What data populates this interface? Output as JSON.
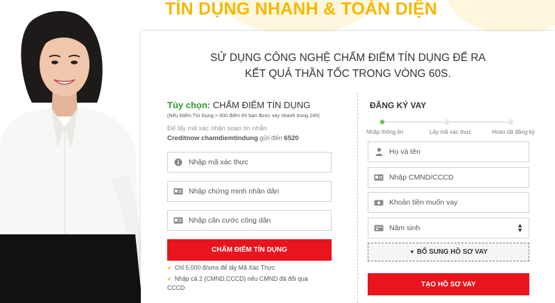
{
  "hero": {
    "title": "TÍN DỤNG NHANH & TOÀN DIỆN"
  },
  "card": {
    "headline_line1": "SỬ DỤNG CÔNG NGHỆ CHẤM ĐIỂM TÍN DỤNG ĐỂ RA",
    "headline_line2": "KẾT QUẢ THẦN TỐC TRONG VÒNG 60S."
  },
  "credit_score": {
    "option_label": "Tùy chọn:",
    "title": "CHẤM ĐIỂM TÍN DỤNG",
    "note": "(Nếu Điểm Tín Dụng > 600 điểm thì bạn được vay nhanh trong 24h)",
    "sms_instruction": "Để lấy mã xác nhận soạn tin nhắn",
    "sms_syntax": "Creditnow chamdiemtindung",
    "sms_send_to": "gửi đến",
    "sms_number": "6520",
    "fields": {
      "verification_code_placeholder": "Nhập mã xác thực",
      "id_card_placeholder": "Nhập chứng minh nhân dân",
      "citizen_id_placeholder": "Nhập căn cước công dân"
    },
    "submit_label": "CHẤM ĐIỂM TÍN DỤNG",
    "tips": [
      "Chỉ 5.000 đ/sms để lấy Mã Xác Thực",
      "Nhập cả 2 (CMND,CCCD) nếu CMND đã đổi qua",
      "CCCD"
    ]
  },
  "register": {
    "title": "ĐĂNG KÝ VAY",
    "steps": [
      "Nhập thông tin",
      "Lấy mã xác thực",
      "Hoàn tất đăng ký"
    ],
    "fields": {
      "full_name_placeholder": "Họ và tên",
      "id_number_placeholder": "Nhập CMND/CCCD",
      "loan_amount_placeholder": "Khoản tiền muốn vay",
      "birth_year_selected": "Năm sinh"
    },
    "supplement_label": "BỔ SUNG HỒ SƠ VAY",
    "submit_label": "TẠO HỒ SƠ VAY"
  },
  "colors": {
    "title_yellow": "#f5b800",
    "button_red": "#e8141e",
    "option_green": "#2e9a2e",
    "step_active": "#6cc04a",
    "check_orange": "#f0a800"
  },
  "icons": [
    "key-icon",
    "id-card-icon",
    "user-icon",
    "money-icon",
    "calendar-icon",
    "check-icon",
    "caret-down-icon",
    "select-arrows-icon"
  ]
}
